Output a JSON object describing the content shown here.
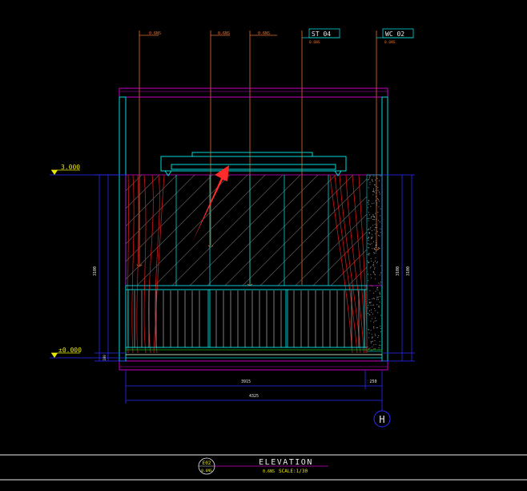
{
  "callouts": {
    "c1": "0.6NS",
    "c2": "0.6NS",
    "c3": "0.6NS",
    "st_tag": "ST 04",
    "st_sub": "0.6NS",
    "wc_tag": "WC 02",
    "wc_sub": "0.6NS"
  },
  "levels": {
    "top": "3.000",
    "bottom": "±0.000"
  },
  "dimensions": {
    "left_height": "3100",
    "left_base": "100",
    "right_height": "3100",
    "right_base": "100",
    "bottom_main": "3915",
    "bottom_side": "250",
    "bottom_total": "4325"
  },
  "marker": {
    "letter": "H"
  },
  "title_block": {
    "badge_top": "E02",
    "badge_bottom": "0.6NS",
    "title": "ELEVATION",
    "subtitle": "0.6NS",
    "scale": "SCALE:1/30"
  },
  "colors": {
    "cyan": "#00d8d8",
    "magenta": "#c800c8",
    "red": "#d01818",
    "yellow": "#e8e800",
    "blue": "#2a2aff",
    "orange": "#e07030",
    "green": "#18b018",
    "white": "#e8e8e8",
    "arrow": "#ff2a2a"
  }
}
